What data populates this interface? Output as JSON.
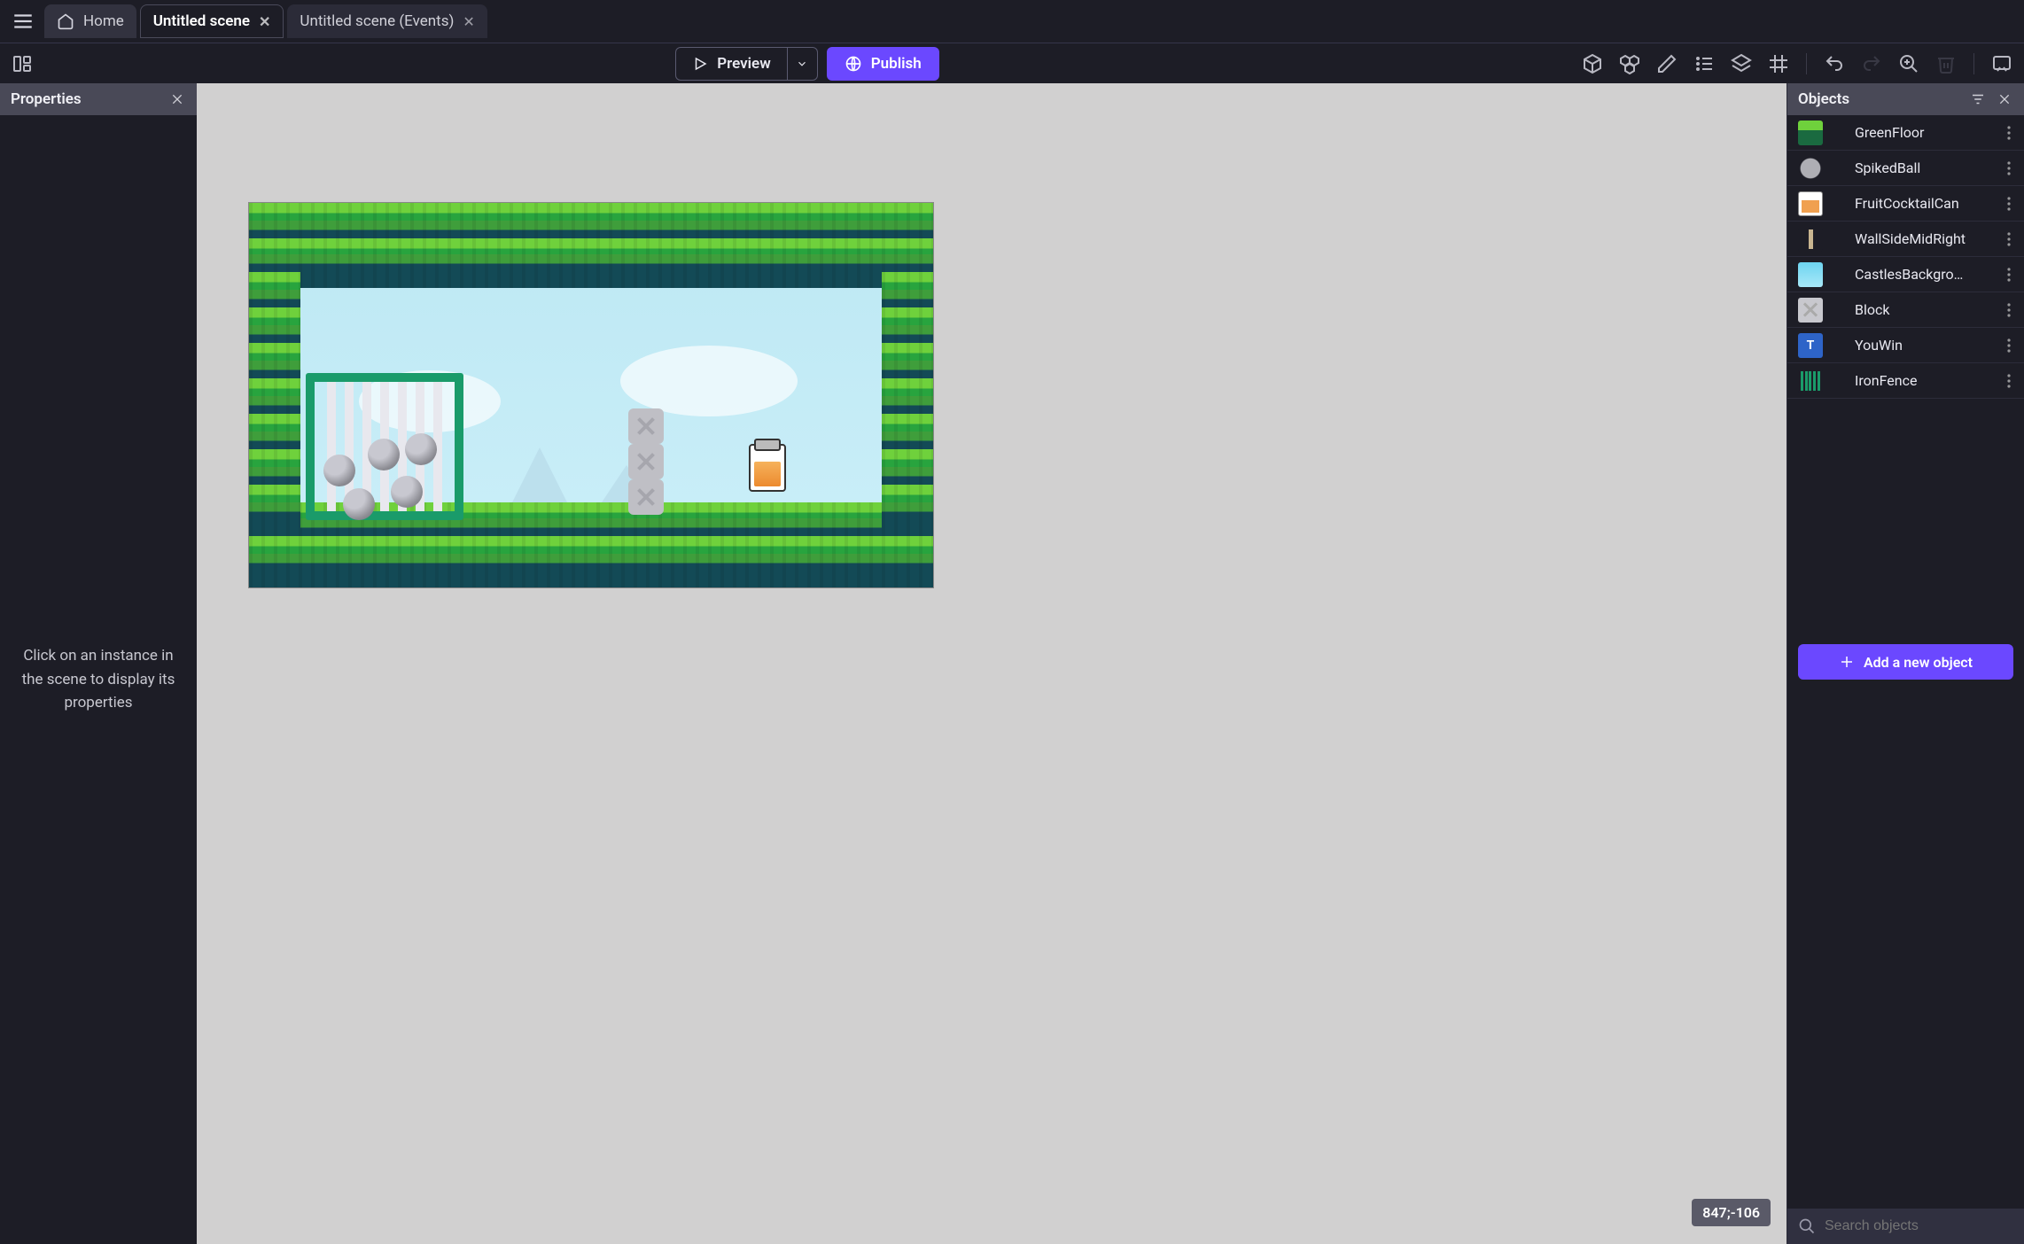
{
  "tabs": {
    "home": "Home",
    "scene": "Untitled scene",
    "events": "Untitled scene (Events)"
  },
  "toolbar": {
    "preview": "Preview",
    "publish": "Publish"
  },
  "panels": {
    "properties_title": "Properties",
    "properties_hint": "Click on an instance in the scene to display its properties",
    "objects_title": "Objects",
    "add_object": "Add a new object",
    "search_placeholder": "Search objects"
  },
  "scene": {
    "coords": "847;-106"
  },
  "objects": [
    {
      "name": "GreenFloor",
      "thumb": "th-green"
    },
    {
      "name": "SpikedBall",
      "thumb": "th-spike"
    },
    {
      "name": "FruitCocktailCan",
      "thumb": "th-jar"
    },
    {
      "name": "WallSideMidRight",
      "thumb": "th-wall"
    },
    {
      "name": "CastlesBackgro…",
      "thumb": "th-castle"
    },
    {
      "name": "Block",
      "thumb": "th-block"
    },
    {
      "name": "YouWin",
      "thumb": "th-text"
    },
    {
      "name": "IronFence",
      "thumb": "th-fence"
    }
  ]
}
